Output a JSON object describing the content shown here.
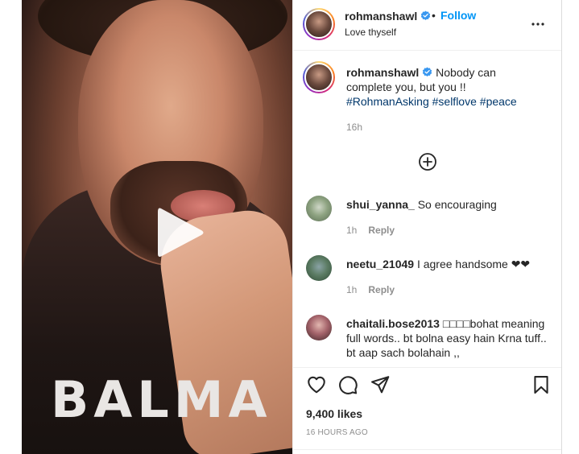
{
  "header": {
    "username": "rohmanshawl",
    "dot": "•",
    "follow_label": "Follow",
    "subtitle": "Love thyself"
  },
  "media": {
    "shirt_text": "BALMA"
  },
  "caption": {
    "username": "rohmanshawl",
    "text_line": "Nobody can complete you, but you !!",
    "hashtags": [
      "#RohmanAsking",
      "#selflove",
      "#peace"
    ],
    "time": "16h"
  },
  "comments": [
    {
      "username": "shui_yanna_",
      "text": "So encouraging",
      "time": "1h",
      "reply_label": "Reply"
    },
    {
      "username": "neetu_21049",
      "text": "I agree handsome ❤❤",
      "time": "1h",
      "reply_label": "Reply"
    },
    {
      "username": "chaitali.bose2013",
      "text": "□□□□bohat meaning full words.. bt bolna easy hain Krna tuff.. bt aap sach bolahain ,,",
      "time": "",
      "reply_label": ""
    }
  ],
  "stats": {
    "likes": "9,400 likes",
    "time_ago": "16 HOURS AGO"
  },
  "icons": {
    "verified": "verified-badge-icon",
    "more": "more-options-icon",
    "load_more": "plus-circle-icon",
    "like": "heart-icon",
    "comment": "comment-icon",
    "share": "share-icon",
    "save": "bookmark-icon",
    "play": "play-icon"
  },
  "colors": {
    "accent": "#0095f6",
    "hashtag": "#00376b",
    "muted": "#8e8e8e",
    "verified": "#3897f0"
  }
}
